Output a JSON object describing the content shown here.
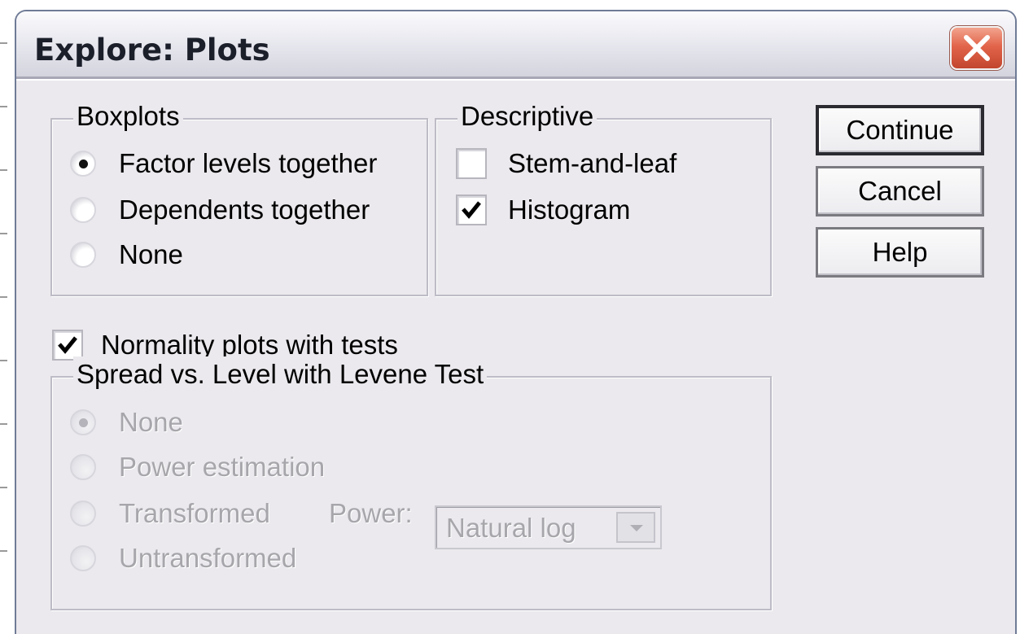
{
  "window": {
    "title": "Explore: Plots"
  },
  "boxplots": {
    "label": "Boxplots",
    "options": [
      {
        "label": "Factor levels together",
        "checked": true
      },
      {
        "label": "Dependents together",
        "checked": false
      },
      {
        "label": "None",
        "checked": false
      }
    ]
  },
  "descriptive": {
    "label": "Descriptive",
    "stem_and_leaf": {
      "label": "Stem-and-leaf",
      "checked": false
    },
    "histogram": {
      "label": "Histogram",
      "checked": true
    }
  },
  "normality": {
    "label": "Normality plots with tests",
    "checked": true
  },
  "spread": {
    "label": "Spread vs. Level with Levene Test",
    "enabled": false,
    "options": [
      {
        "label": "None",
        "checked": true
      },
      {
        "label": "Power estimation",
        "checked": false
      },
      {
        "label": "Transformed",
        "checked": false
      },
      {
        "label": "Untransformed",
        "checked": false
      }
    ],
    "power_label": "Power:",
    "power_value": "Natural log"
  },
  "buttons": {
    "continue": "Continue",
    "cancel": "Cancel",
    "help": "Help"
  }
}
